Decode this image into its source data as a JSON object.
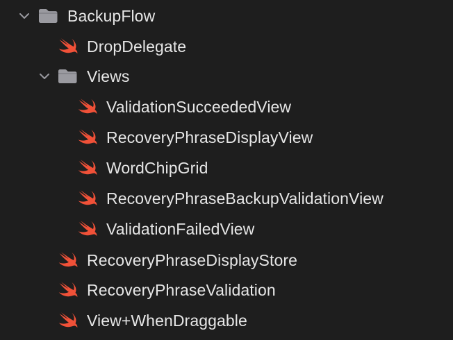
{
  "navigator": {
    "colors": {
      "background": "#1e1e1e",
      "text": "#e6e6e6",
      "folder": "#9a9aa0",
      "chevron": "#9a9aa0",
      "swift": "#f05138"
    },
    "root": {
      "label": "BackupFlow",
      "icon": "folder-icon",
      "expanded": true
    },
    "items": [
      {
        "label": "DropDelegate",
        "icon": "swift-file-icon"
      },
      {
        "label": "Views",
        "icon": "folder-icon",
        "expanded": true
      },
      {
        "label": "ValidationSucceededView",
        "icon": "swift-file-icon"
      },
      {
        "label": "RecoveryPhraseDisplayView",
        "icon": "swift-file-icon"
      },
      {
        "label": "WordChipGrid",
        "icon": "swift-file-icon"
      },
      {
        "label": "RecoveryPhraseBackupValidationView",
        "icon": "swift-file-icon"
      },
      {
        "label": "ValidationFailedView",
        "icon": "swift-file-icon"
      },
      {
        "label": "RecoveryPhraseDisplayStore",
        "icon": "swift-file-icon"
      },
      {
        "label": "RecoveryPhraseValidation",
        "icon": "swift-file-icon"
      },
      {
        "label": "View+WhenDraggable",
        "icon": "swift-file-icon"
      }
    ]
  }
}
